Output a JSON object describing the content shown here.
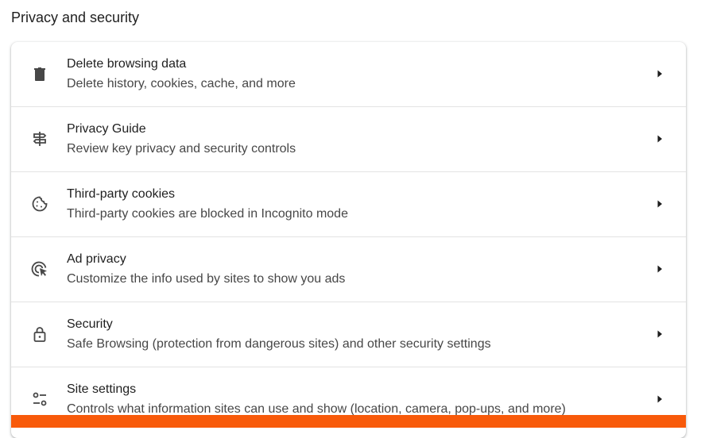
{
  "section": {
    "title": "Privacy and security"
  },
  "rows": [
    {
      "icon": "trash-icon",
      "label": "Delete browsing data",
      "sub": "Delete history, cookies, cache, and more"
    },
    {
      "icon": "signpost-icon",
      "label": "Privacy Guide",
      "sub": "Review key privacy and security controls"
    },
    {
      "icon": "cookie-icon",
      "label": "Third-party cookies",
      "sub": "Third-party cookies are blocked in Incognito mode"
    },
    {
      "icon": "ad-privacy-icon",
      "label": "Ad privacy",
      "sub": "Customize the info used by sites to show you ads"
    },
    {
      "icon": "lock-icon",
      "label": "Security",
      "sub": "Safe Browsing (protection from dangerous sites) and other security settings"
    },
    {
      "icon": "tune-icon",
      "label": "Site settings",
      "sub": "Controls what information sites can use and show (location, camera, pop-ups, and more)"
    }
  ],
  "colors": {
    "accent_bar": "#f85a0a",
    "icon": "#474747",
    "divider": "#e3e3e3"
  }
}
